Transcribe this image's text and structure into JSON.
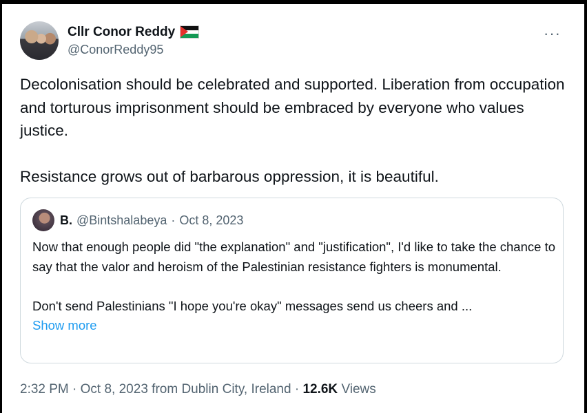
{
  "author": {
    "name": "Cllr Conor Reddy",
    "handle": "@ConorReddy95",
    "flag_icon": "palestine-flag-icon"
  },
  "more_icon": "more-horizontal-icon",
  "more_glyph": "···",
  "tweet": {
    "paragraphs": [
      "Decolonisation should be celebrated and supported. Liberation from occupation and torturous imprisonment should be embraced by everyone who values justice.",
      "Resistance grows out of barbarous oppression, it is beautiful."
    ]
  },
  "quoted": {
    "name": "B.",
    "handle": "@Bintshalabeya",
    "separator": "·",
    "date": "Oct 8, 2023",
    "paragraphs": [
      "Now that enough people did \"the explanation\" and \"justification\", I'd like to take the chance to say that the valor and heroism of the Palestinian resistance fighters is monumental.",
      "Don't send Palestinians \"I hope you're okay\" messages send us cheers and ..."
    ],
    "show_more": "Show more"
  },
  "footer": {
    "time": "2:32 PM",
    "sep1": "·",
    "date": "Oct 8, 2023",
    "location": "from Dublin City, Ireland",
    "sep2": "·",
    "views_count": "12.6K",
    "views_label": "Views"
  },
  "colors": {
    "text": "#0f1419",
    "secondary": "#536471",
    "link": "#1d9bf0",
    "border": "#cfd9de"
  }
}
